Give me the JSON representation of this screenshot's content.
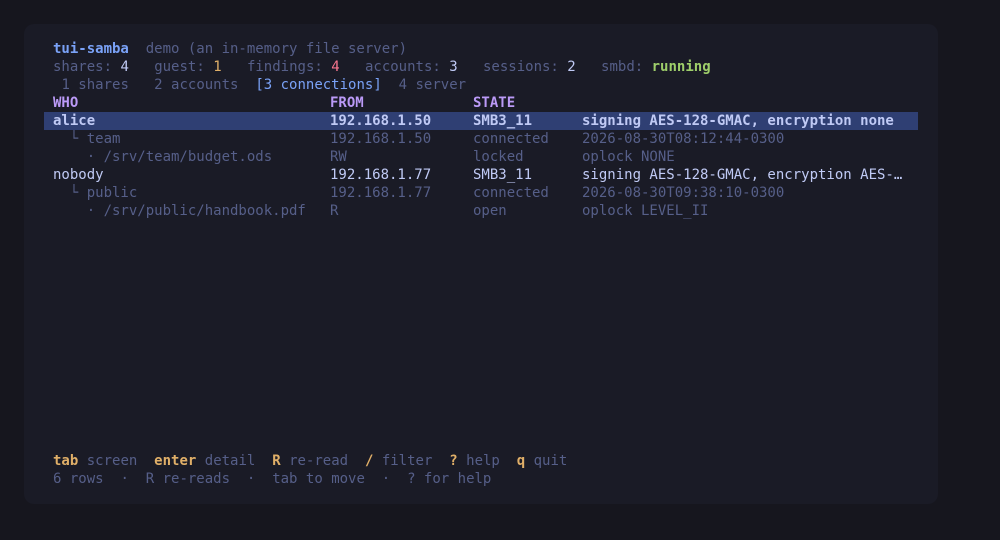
{
  "header": {
    "app_name": "tui-samba",
    "subtitle": "demo (an in-memory file server)"
  },
  "stats": {
    "shares_label": "shares:",
    "shares": "4",
    "guest_label": "guest:",
    "guest": "1",
    "findings_label": "findings:",
    "findings": "4",
    "accounts_label": "accounts:",
    "accounts": "3",
    "sessions_label": "sessions:",
    "sessions": "2",
    "smbd_label": "smbd:",
    "smbd": "running"
  },
  "tabs": [
    {
      "label": "1 shares"
    },
    {
      "label": "2 accounts"
    },
    {
      "label": "[3 connections]"
    },
    {
      "label": "4 server"
    }
  ],
  "table": {
    "columns": [
      "WHO",
      "FROM",
      "STATE",
      ""
    ],
    "rows": [
      {
        "who": "alice",
        "from": "192.168.1.50",
        "state": "SMB3_11",
        "detail": "signing AES-128-GMAC, encryption none"
      },
      {
        "who": "  └ team",
        "from": "192.168.1.50",
        "state": "connected",
        "detail": "2026-08-30T08:12:44-0300"
      },
      {
        "who": "    · /srv/team/budget.ods",
        "from": "RW",
        "state": "locked",
        "detail": "oplock NONE"
      },
      {
        "who": "nobody",
        "from": "192.168.1.77",
        "state": "SMB3_11",
        "detail": "signing AES-128-GMAC, encryption AES-…"
      },
      {
        "who": "  └ public",
        "from": "192.168.1.77",
        "state": "connected",
        "detail": "2026-08-30T09:38:10-0300"
      },
      {
        "who": "    · /srv/public/handbook.pdf",
        "from": "R",
        "state": "open",
        "detail": "oplock LEVEL_II"
      }
    ]
  },
  "keybar": [
    {
      "key": "tab",
      "label": "screen"
    },
    {
      "key": "enter",
      "label": "detail"
    },
    {
      "key": "R",
      "label": "re-read"
    },
    {
      "key": "/",
      "label": "filter"
    },
    {
      "key": "?",
      "label": "help"
    },
    {
      "key": "q",
      "label": "quit"
    }
  ],
  "status": {
    "rows": "6 rows",
    "sep": "·",
    "hint1": "R re-reads",
    "hint2": "tab to move",
    "hint3": "? for help"
  }
}
